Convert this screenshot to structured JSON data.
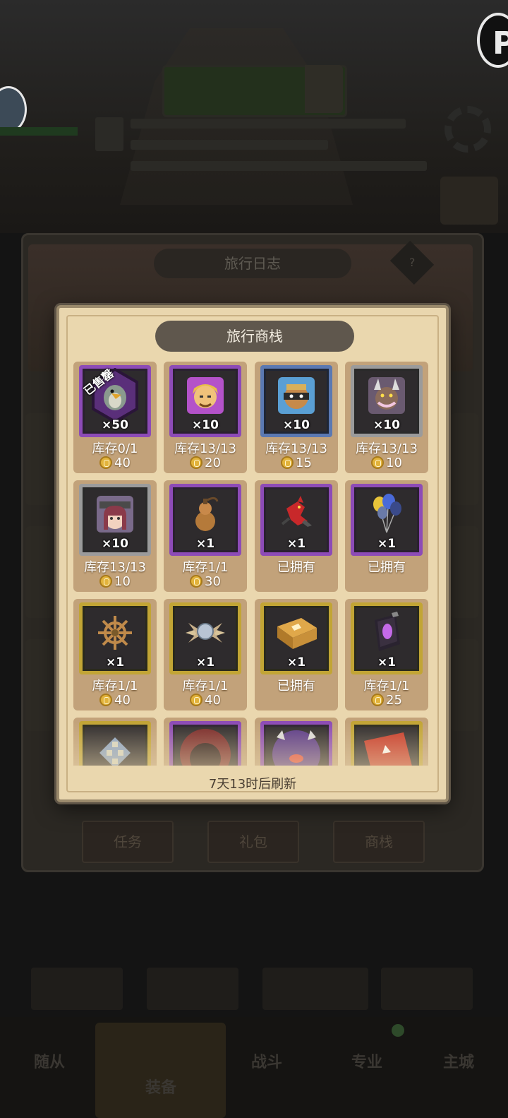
{
  "background": {
    "journal_title": "旅行日志",
    "journal_help": "?",
    "tabs": [
      {
        "label": "任务"
      },
      {
        "label": "礼包"
      },
      {
        "label": "商栈"
      }
    ],
    "nav": [
      {
        "label": "随从"
      },
      {
        "label": "装备"
      },
      {
        "label": "战斗"
      },
      {
        "label": "专业"
      },
      {
        "label": "主城"
      }
    ]
  },
  "modal": {
    "title": "旅行商栈",
    "refresh_text": "7天13时后刷新",
    "items": [
      {
        "icon": "penguin-hex-icon",
        "frame": "purple",
        "qty": "×50",
        "stock": "库存0/1",
        "price": "40",
        "sold": "已售罄"
      },
      {
        "icon": "blonde-hero-portrait-icon",
        "frame": "purple",
        "qty": "×10",
        "stock": "库存13/13",
        "price": "20"
      },
      {
        "icon": "masked-ninja-portrait-icon",
        "frame": "blue",
        "qty": "×10",
        "stock": "库存13/13",
        "price": "15"
      },
      {
        "icon": "horned-beast-portrait-icon",
        "frame": "gray",
        "qty": "×10",
        "stock": "库存13/13",
        "price": "10"
      },
      {
        "icon": "girl-portrait-icon",
        "frame": "gray",
        "qty": "×10",
        "stock": "库存13/13",
        "price": "10"
      },
      {
        "icon": "gourd-icon",
        "frame": "purple",
        "qty": "×1",
        "stock": "库存1/1",
        "price": "30"
      },
      {
        "icon": "red-dragon-icon",
        "frame": "purple",
        "qty": "×1",
        "stock": "已拥有",
        "price": ""
      },
      {
        "icon": "balloons-icon",
        "frame": "purple",
        "qty": "×1",
        "stock": "已拥有",
        "price": ""
      },
      {
        "icon": "ship-wheel-icon",
        "frame": "gold",
        "qty": "×1",
        "stock": "库存1/1",
        "price": "40"
      },
      {
        "icon": "spiked-orb-icon",
        "frame": "gold",
        "qty": "×1",
        "stock": "库存1/1",
        "price": "40"
      },
      {
        "icon": "treasure-book-icon",
        "frame": "gold",
        "qty": "×1",
        "stock": "已拥有",
        "price": ""
      },
      {
        "icon": "purple-tome-icon",
        "frame": "gold",
        "qty": "×1",
        "stock": "库存1/1",
        "price": "25"
      },
      {
        "icon": "checkered-bag-icon",
        "frame": "gold",
        "qty": "",
        "stock": "",
        "price": ""
      },
      {
        "icon": "red-hood-portrait-icon",
        "frame": "purple",
        "qty": "",
        "stock": "",
        "price": ""
      },
      {
        "icon": "purple-demon-portrait-icon",
        "frame": "purple",
        "qty": "",
        "stock": "",
        "price": ""
      },
      {
        "icon": "red-spellbook-icon",
        "frame": "gold",
        "qty": "",
        "stock": "",
        "price": ""
      }
    ]
  }
}
